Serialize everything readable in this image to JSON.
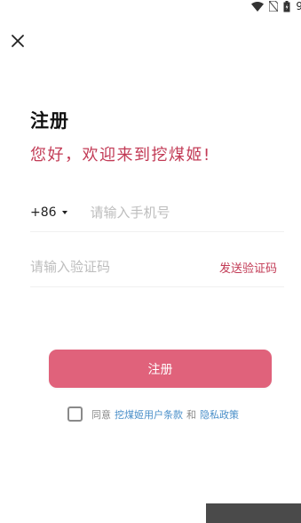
{
  "status_bar": {
    "time_fragment": "9",
    "icons": [
      "wifi-icon",
      "no-sim-icon",
      "battery-icon"
    ]
  },
  "icons": {
    "close": "close-icon"
  },
  "page": {
    "title": "注册",
    "subtitle": "您好，欢迎来到挖煤姬!"
  },
  "phone": {
    "country_code": "+86",
    "placeholder": "请输入手机号"
  },
  "code": {
    "placeholder": "请输入验证码",
    "send_label": "发送验证码"
  },
  "submit": {
    "label": "注册"
  },
  "agreement": {
    "prefix": "同意",
    "terms_link": "挖煤姬用户条款",
    "and": "和",
    "privacy_link": "隐私政策",
    "checked": false
  },
  "colors": {
    "accent": "#c23a55",
    "button": "#e0627b",
    "link": "#4a8fc9"
  }
}
